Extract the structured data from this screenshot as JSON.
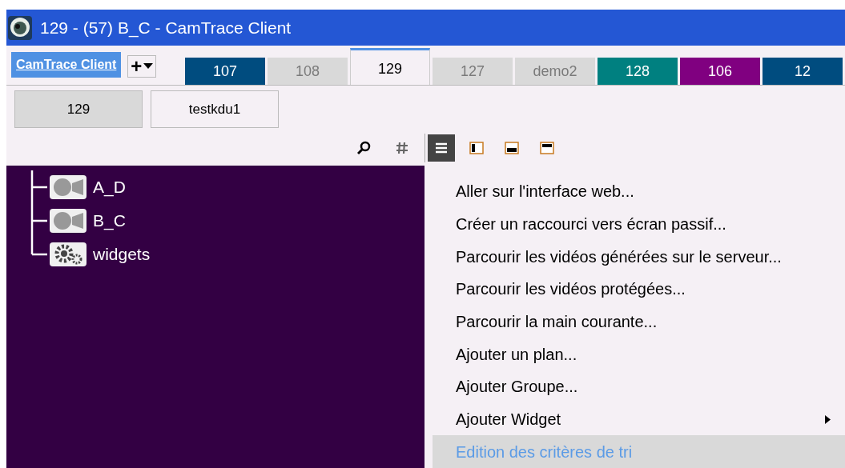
{
  "window": {
    "title": "129 -  (57) B_C - CamTrace Client"
  },
  "app_button": {
    "label": "CamTrace Client"
  },
  "add_button": {
    "label": "+"
  },
  "tabs": [
    {
      "label": "107",
      "selected": false,
      "color": "#004c7f"
    },
    {
      "label": "108",
      "selected": false,
      "color": "#d9d9d9"
    },
    {
      "label": "129",
      "selected": true,
      "color": "#f5f0f5"
    },
    {
      "label": "127",
      "selected": false,
      "color": "#d9d9d9"
    },
    {
      "label": "demo2",
      "selected": false,
      "color": "#d9d9d9"
    },
    {
      "label": "128",
      "selected": false,
      "color": "#008080"
    },
    {
      "label": "106",
      "selected": false,
      "color": "#800080"
    },
    {
      "label": "12",
      "selected": false,
      "color": "#004c7f"
    }
  ],
  "sub_tabs": [
    {
      "label": "129",
      "selected": true
    },
    {
      "label": "testkdu1",
      "selected": false
    }
  ],
  "view_buttons": [
    {
      "kind": "list",
      "selected": true
    },
    {
      "kind": "left",
      "selected": false
    },
    {
      "kind": "bottom",
      "selected": false
    },
    {
      "kind": "top",
      "selected": false
    }
  ],
  "tree": {
    "children": [
      {
        "label": "A_D",
        "kind": "camera"
      },
      {
        "label": "B_C",
        "kind": "camera"
      },
      {
        "label": "widgets",
        "kind": "widgets"
      }
    ]
  },
  "menu": [
    {
      "label": "Aller sur l'interface web...",
      "highlighted": false,
      "submenu": false
    },
    {
      "label": "Créer un raccourci vers écran passif...",
      "highlighted": false,
      "submenu": false
    },
    {
      "label": "Parcourir les vidéos générées sur le serveur...",
      "highlighted": false,
      "submenu": false
    },
    {
      "label": "Parcourir les vidéos protégées...",
      "highlighted": false,
      "submenu": false
    },
    {
      "label": "Parcourir la main courante...",
      "highlighted": false,
      "submenu": false
    },
    {
      "label": "Ajouter un plan...",
      "highlighted": false,
      "submenu": false
    },
    {
      "label": "Ajouter Groupe...",
      "highlighted": false,
      "submenu": false
    },
    {
      "label": "Ajouter Widget",
      "highlighted": false,
      "submenu": true
    },
    {
      "label": "Edition des critères de tri",
      "highlighted": true,
      "submenu": false
    }
  ]
}
